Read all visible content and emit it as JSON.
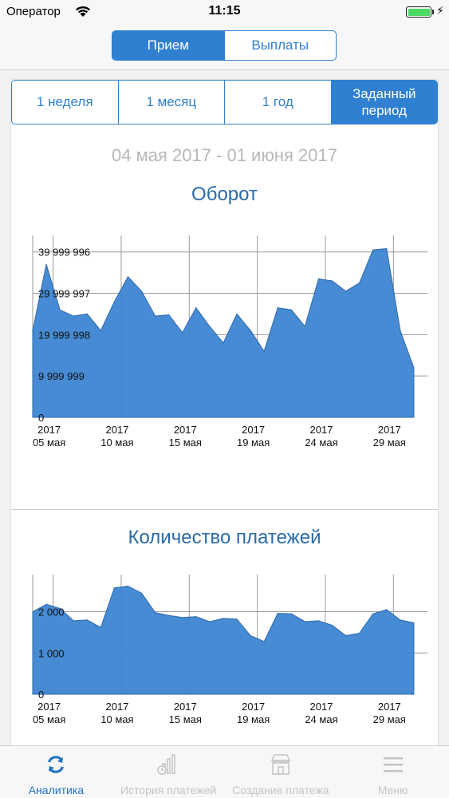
{
  "status_bar": {
    "carrier": "Оператор",
    "time": "11:15",
    "battery_level": 1.0
  },
  "segment": {
    "items": [
      "Прием",
      "Выплаты"
    ],
    "active_index": 0
  },
  "periods": {
    "items": [
      "1 неделя",
      "1 месяц",
      "1 год",
      "Заданный период"
    ],
    "active_index": 3
  },
  "date_range": "04 мая 2017 - 01 июня 2017",
  "charts": [
    {
      "type": "area",
      "title": "Оборот",
      "yticks": [
        0,
        9999999,
        19999998,
        29999997,
        39999996
      ],
      "ytick_labels": [
        "0",
        "9 999 999",
        "19 999 998",
        "29 999 997",
        "39 999 996"
      ],
      "ylim": [
        0,
        44000000
      ],
      "xlim": [
        0,
        29
      ],
      "x_tick_positions": [
        1.5,
        6.5,
        11.5,
        16.5,
        21.5,
        26.5
      ],
      "x_tick_years": [
        "2017",
        "2017",
        "2017",
        "2017",
        "2017",
        "2017"
      ],
      "x_tick_days": [
        "05 мая",
        "10 мая",
        "15 мая",
        "19 мая",
        "24 мая",
        "29 мая"
      ],
      "grid": true,
      "color": "#3c85d2",
      "values": [
        21000000,
        37000000,
        26000000,
        24500000,
        25000000,
        21000000,
        28000000,
        34000000,
        30500000,
        24500000,
        24800000,
        20500000,
        26500000,
        22000000,
        18000000,
        25000000,
        21000000,
        16000000,
        26500000,
        26000000,
        22000000,
        33500000,
        33000000,
        30500000,
        32500000,
        40500000,
        40800000,
        21000000,
        12000000
      ]
    },
    {
      "type": "area",
      "title": "Количество платежей",
      "yticks": [
        0,
        1000,
        2000
      ],
      "ytick_labels": [
        "0",
        "1 000",
        "2 000"
      ],
      "ylim": [
        0,
        2900
      ],
      "xlim": [
        0,
        29
      ],
      "x_tick_positions": [
        1.5,
        6.5,
        11.5,
        16.5,
        21.5,
        26.5
      ],
      "x_tick_years": [
        "2017",
        "2017",
        "2017",
        "2017",
        "2017",
        "2017"
      ],
      "x_tick_days": [
        "05 мая",
        "10 мая",
        "15 мая",
        "19 мая",
        "24 мая",
        "29 мая"
      ],
      "grid": true,
      "color": "#3c85d2",
      "values": [
        2000,
        2180,
        2080,
        1780,
        1800,
        1620,
        2580,
        2620,
        2450,
        1980,
        1910,
        1860,
        1880,
        1760,
        1840,
        1820,
        1420,
        1280,
        1960,
        1950,
        1760,
        1780,
        1670,
        1420,
        1480,
        1950,
        2050,
        1800,
        1730
      ]
    }
  ],
  "tabbar": {
    "items": [
      {
        "label": "Аналитика",
        "icon": "refresh-icon"
      },
      {
        "label": "История платежей",
        "icon": "history-icon"
      },
      {
        "label": "Создание платежа",
        "icon": "store-icon"
      },
      {
        "label": "Меню",
        "icon": "menu-icon"
      }
    ],
    "active_index": 0,
    "active_color": "#1f72c4",
    "inactive_color": "#c4c4c4"
  }
}
